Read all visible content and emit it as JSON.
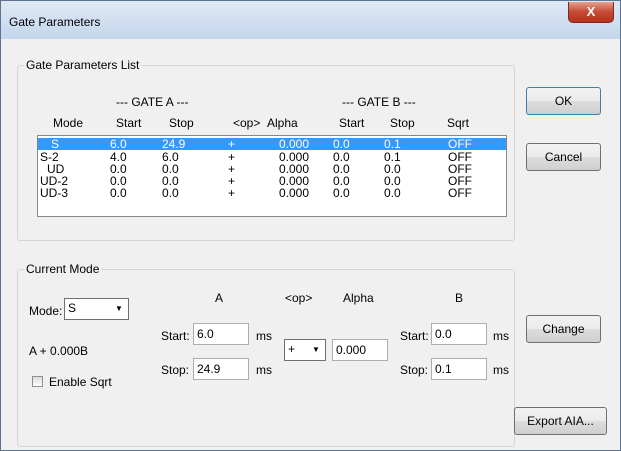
{
  "window": {
    "title": "Gate Parameters",
    "close_glyph": "X"
  },
  "list": {
    "legend": "Gate Parameters List",
    "group_a": "--- GATE A ---",
    "group_b": "--- GATE B ---",
    "headers": {
      "mode": "Mode",
      "a_start": "Start",
      "a_stop": "Stop",
      "op": "<op>",
      "alpha": "Alpha",
      "b_start": "Start",
      "b_stop": "Stop",
      "sqrt": "Sqrt"
    },
    "rows": [
      {
        "mode": "S",
        "a_start": "6.0",
        "a_stop": "24.9",
        "op": "+",
        "alpha": "0.000",
        "b_start": "0.0",
        "b_stop": "0.1",
        "sqrt": "OFF"
      },
      {
        "mode": "S-2",
        "a_start": "4.0",
        "a_stop": "6.0",
        "op": "+",
        "alpha": "0.000",
        "b_start": "0.0",
        "b_stop": "0.1",
        "sqrt": "OFF"
      },
      {
        "mode": "UD",
        "a_start": "0.0",
        "a_stop": "0.0",
        "op": "+",
        "alpha": "0.000",
        "b_start": "0.0",
        "b_stop": "0.0",
        "sqrt": "OFF"
      },
      {
        "mode": "UD-2",
        "a_start": "0.0",
        "a_stop": "0.0",
        "op": "+",
        "alpha": "0.000",
        "b_start": "0.0",
        "b_stop": "0.0",
        "sqrt": "OFF"
      },
      {
        "mode": "UD-3",
        "a_start": "0.0",
        "a_stop": "0.0",
        "op": "+",
        "alpha": "0.000",
        "b_start": "0.0",
        "b_stop": "0.0",
        "sqrt": "OFF"
      }
    ]
  },
  "current": {
    "legend": "Current Mode",
    "mode_label": "Mode:",
    "mode_value": "S",
    "formula": "A + 0.000B",
    "enable_sqrt": "Enable Sqrt",
    "col_a": "A",
    "col_op": "<op>",
    "col_alpha": "Alpha",
    "col_b": "B",
    "start_label": "Start:",
    "stop_label": "Stop:",
    "unit": "ms",
    "a_start": "6.0",
    "a_stop": "24.9",
    "op_value": "+",
    "alpha_value": "0.000",
    "b_start": "0.0",
    "b_stop": "0.1"
  },
  "buttons": {
    "ok": "OK",
    "cancel": "Cancel",
    "change": "Change",
    "export": "Export AIA..."
  },
  "colors": {
    "selection": "#3399ff",
    "window_bg": "#f0f0f0",
    "close": "#c54a33"
  }
}
